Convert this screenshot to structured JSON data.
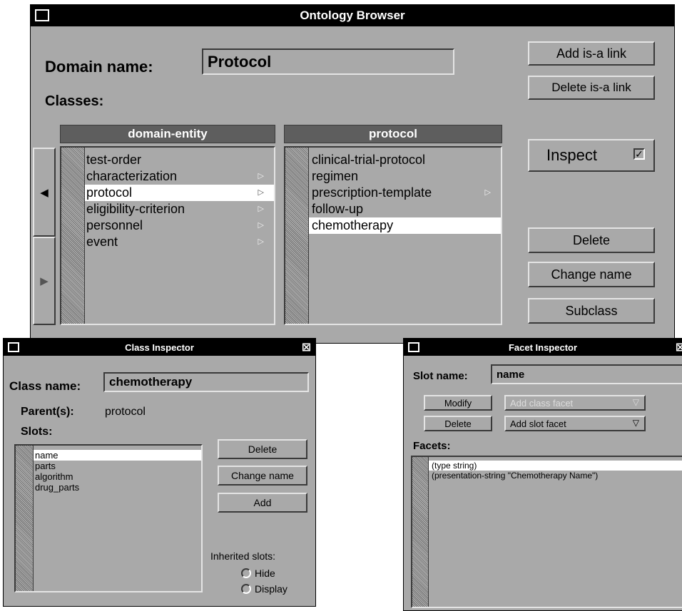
{
  "ontology_browser": {
    "title": "Ontology Browser",
    "domain_label": "Domain name:",
    "domain_value": "Protocol",
    "classes_label": "Classes:",
    "buttons": {
      "add_isa": "Add is-a link",
      "delete_isa": "Delete is-a link",
      "inspect": "Inspect",
      "delete": "Delete",
      "change_name": "Change name",
      "subclass": "Subclass"
    },
    "column1": {
      "header": "domain-entity",
      "items": [
        {
          "label": "test-order",
          "has_children": false,
          "selected": false
        },
        {
          "label": "characterization",
          "has_children": true,
          "selected": false
        },
        {
          "label": "protocol",
          "has_children": true,
          "selected": true
        },
        {
          "label": "eligibility-criterion",
          "has_children": true,
          "selected": false
        },
        {
          "label": "personnel",
          "has_children": true,
          "selected": false
        },
        {
          "label": "event",
          "has_children": true,
          "selected": false
        }
      ]
    },
    "column2": {
      "header": "protocol",
      "items": [
        {
          "label": "clinical-trial-protocol",
          "has_children": false,
          "selected": false
        },
        {
          "label": "regimen",
          "has_children": false,
          "selected": false
        },
        {
          "label": "prescription-template",
          "has_children": true,
          "selected": false
        },
        {
          "label": "follow-up",
          "has_children": false,
          "selected": false
        },
        {
          "label": "chemotherapy",
          "has_children": false,
          "selected": true
        }
      ]
    }
  },
  "class_inspector": {
    "title": "Class Inspector",
    "class_name_label": "Class name:",
    "class_name_value": "chemotherapy",
    "parents_label": "Parent(s):",
    "parents_value": "protocol",
    "slots_label": "Slots:",
    "slots": [
      {
        "label": "name",
        "selected": true
      },
      {
        "label": "parts",
        "selected": false
      },
      {
        "label": "algorithm",
        "selected": false
      },
      {
        "label": "drug_parts",
        "selected": false
      }
    ],
    "buttons": {
      "delete": "Delete",
      "change_name": "Change name",
      "add": "Add"
    },
    "inherited_label": "Inherited slots:",
    "radio_hide": "Hide",
    "radio_display": "Display"
  },
  "facet_inspector": {
    "title": "Facet Inspector",
    "slot_name_label": "Slot name:",
    "slot_name_value": "name",
    "modify_label": "Modify",
    "delete_label": "Delete",
    "add_class_facet": "Add class facet",
    "add_slot_facet": "Add slot facet",
    "facets_label": "Facets:",
    "facets": [
      {
        "label": "(type  string)",
        "selected": true
      },
      {
        "label": "(presentation-string  \"Chemotherapy Name\")",
        "selected": false
      }
    ]
  }
}
